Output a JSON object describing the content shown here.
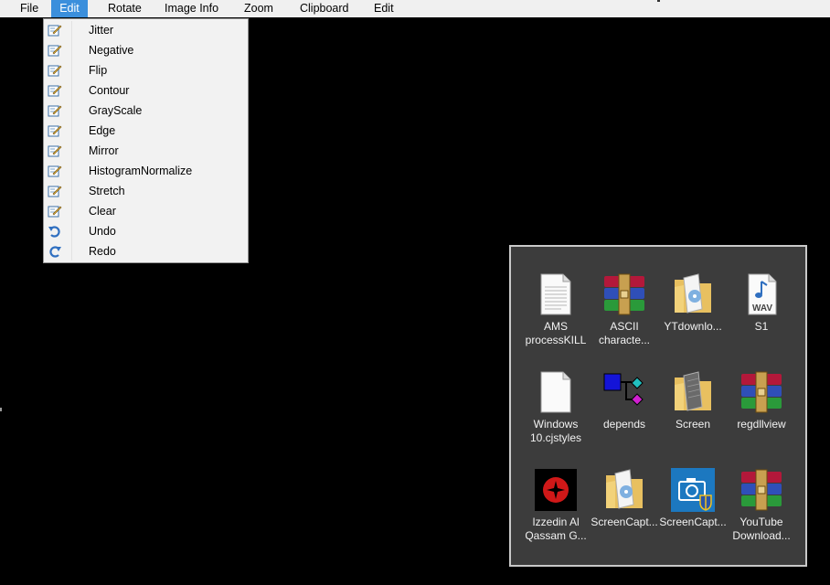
{
  "menubar": {
    "items": [
      {
        "label": "File"
      },
      {
        "label": "Edit"
      },
      {
        "label": "Rotate"
      },
      {
        "label": "Image Info"
      },
      {
        "label": "Zoom"
      },
      {
        "label": "Clipboard"
      },
      {
        "label": "Edit"
      }
    ]
  },
  "edit_menu": {
    "items": [
      {
        "label": "Jitter",
        "icon": "edit-icon"
      },
      {
        "label": "Negative",
        "icon": "edit-icon"
      },
      {
        "label": "Flip",
        "icon": "edit-icon"
      },
      {
        "label": "Contour",
        "icon": "edit-icon"
      },
      {
        "label": "GrayScale",
        "icon": "edit-icon"
      },
      {
        "label": "Edge",
        "icon": "edit-icon"
      },
      {
        "label": "Mirror",
        "icon": "edit-icon"
      },
      {
        "label": "HistogramNormalize",
        "icon": "edit-icon"
      },
      {
        "label": "Stretch",
        "icon": "edit-icon"
      },
      {
        "label": "Clear",
        "icon": "edit-icon"
      },
      {
        "label": "Undo",
        "icon": "undo-icon"
      },
      {
        "label": "Redo",
        "icon": "redo-icon"
      }
    ]
  },
  "desktop": {
    "icons": [
      {
        "line1": "AMS",
        "line2": "processKILL",
        "icon": "text-file-icon"
      },
      {
        "line1": "ASCII",
        "line2": "characte...",
        "icon": "winrar-archive-icon"
      },
      {
        "line1": "YTdownlo...",
        "line2": "",
        "icon": "folder-icon"
      },
      {
        "line1": "S1",
        "line2": "",
        "icon": "wav-file-icon"
      },
      {
        "line1": "Windows",
        "line2": "10.cjstyles",
        "icon": "blank-file-icon"
      },
      {
        "line1": "depends",
        "line2": "",
        "icon": "depends-icon"
      },
      {
        "line1": "Screen",
        "line2": "",
        "icon": "folder-icon"
      },
      {
        "line1": "regdllview",
        "line2": "",
        "icon": "winrar-archive-icon"
      },
      {
        "line1": "Izzedin Al",
        "line2": "Qassam G...",
        "icon": "emblem-icon"
      },
      {
        "line1": "ScreenCapt...",
        "line2": "",
        "icon": "folder-icon"
      },
      {
        "line1": "ScreenCapt...",
        "line2": "",
        "icon": "camera-app-icon"
      },
      {
        "line1": "YouTube",
        "line2": "Download...",
        "icon": "winrar-archive-icon"
      }
    ]
  },
  "colors": {
    "menubar_bg": "#f0f0f0",
    "menu_highlight": "#3b8fdc",
    "panel_bg": "#3c3c3c",
    "canvas_bg": "#000000"
  }
}
